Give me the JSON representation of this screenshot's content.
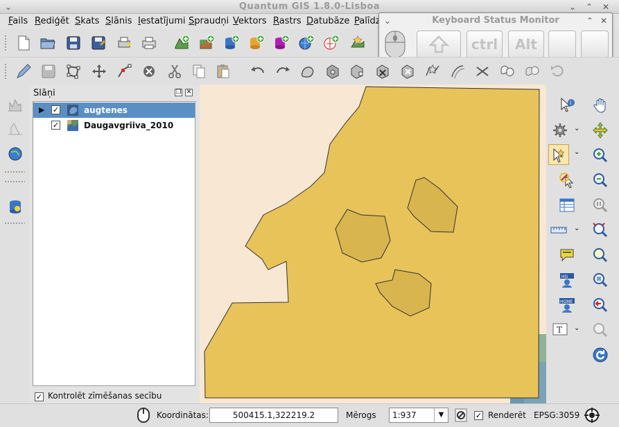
{
  "window": {
    "title": "Quantum GIS 1.8.0-Lisboa"
  },
  "menu": {
    "items": [
      "Fails",
      "Rediģēt",
      "Skats",
      "Slānis",
      "Iestatījumi",
      "Spraudņi",
      "Vektors",
      "Rastrs",
      "Datubāze",
      "Palīdz"
    ]
  },
  "kbd_monitor": {
    "title": "Keyboard Status Monitor",
    "keys": [
      "",
      "ctrl",
      "Alt",
      "",
      ""
    ]
  },
  "layers_panel": {
    "title": "Slāņi",
    "layers": [
      {
        "name": "augtenes",
        "checked": true,
        "selected": true
      },
      {
        "name": "Daugavgriiva_2010",
        "checked": true,
        "selected": false
      }
    ],
    "render_order_label": "Kontrolēt zīmēšanas secību",
    "render_order_checked": true
  },
  "status": {
    "coordinates_label": "Koordinātas:",
    "coordinates_value": "500415.1,322219.2",
    "scale_label": "Mērogs",
    "scale_value": "1:937",
    "render_label": "Renderēt",
    "render_checked": true,
    "crs": "EPSG:3059"
  },
  "colors": {
    "polygon_fill": "#e8c35a",
    "selection": "#5a8fc4",
    "map_background": "#f5e3c8"
  }
}
